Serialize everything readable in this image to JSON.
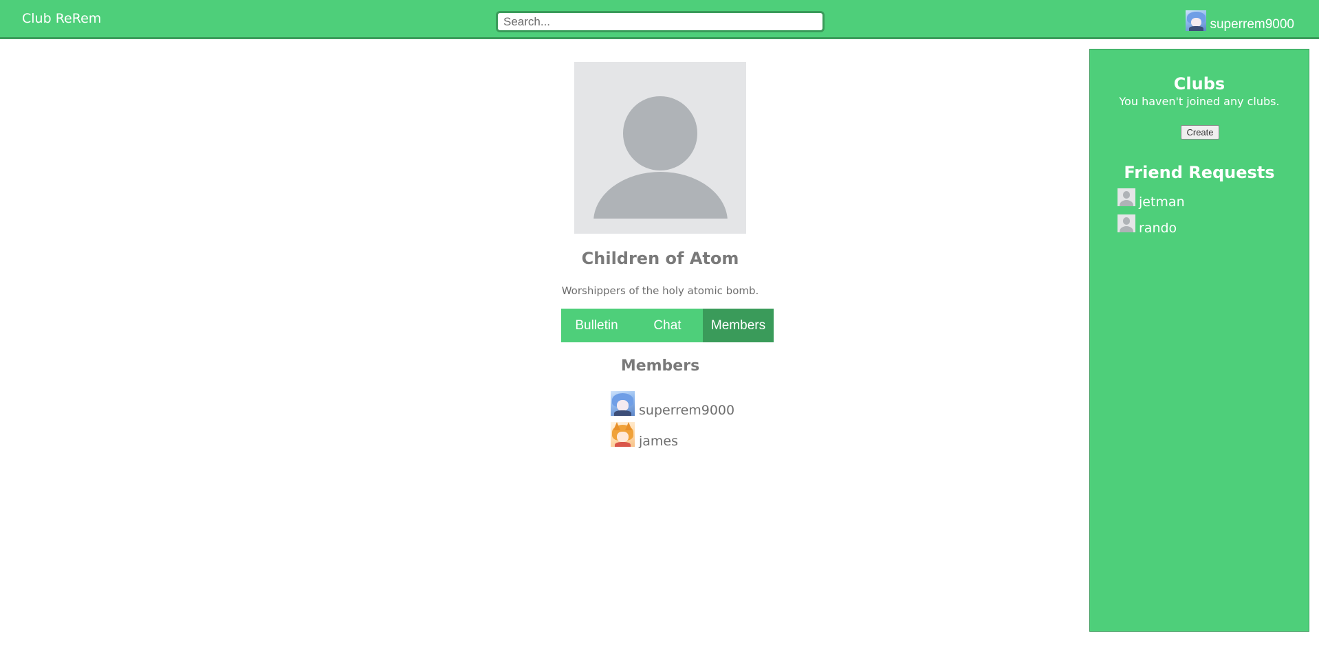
{
  "header": {
    "brand": "Club ReRem",
    "search_placeholder": "Search...",
    "search_value": "",
    "username": "superrem9000"
  },
  "club": {
    "name": "Children of Atom",
    "description": "Worshippers of the holy atomic bomb.",
    "tabs": [
      {
        "label": "Bulletin",
        "active": false
      },
      {
        "label": "Chat",
        "active": false
      },
      {
        "label": "Members",
        "active": true
      }
    ],
    "members_heading": "Members",
    "members": [
      {
        "name": "superrem9000",
        "avatar": "blue-hair-anime-avatar"
      },
      {
        "name": "james",
        "avatar": "orange-hair-anime-avatar"
      }
    ]
  },
  "sidebar": {
    "clubs_title": "Clubs",
    "clubs_empty": "You haven't joined any clubs.",
    "create_label": "Create",
    "friend_requests_title": "Friend Requests",
    "friend_requests": [
      {
        "name": "jetman",
        "avatar": "default-user-avatar"
      },
      {
        "name": "rando",
        "avatar": "default-user-avatar"
      }
    ]
  },
  "colors": {
    "primary": "#4ecf7a",
    "primary_dark": "#3a9b5a",
    "text_gray": "#7a7a7a",
    "placeholder_gray": "#e4e5e7"
  }
}
